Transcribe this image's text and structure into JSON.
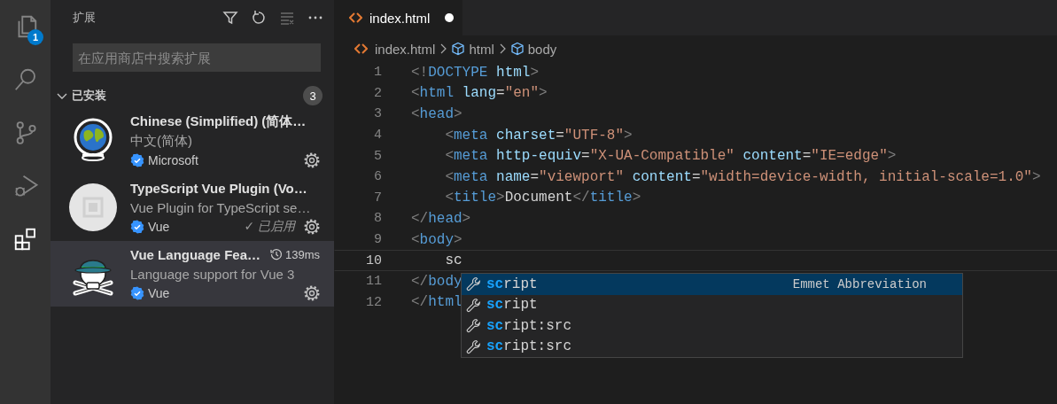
{
  "activity_bar": {
    "items": [
      {
        "kind": "files",
        "selected": false,
        "badge": "1"
      },
      {
        "kind": "search",
        "selected": false
      },
      {
        "kind": "source-control",
        "selected": false
      },
      {
        "kind": "run-debug",
        "selected": false
      },
      {
        "kind": "extensions",
        "selected": true
      }
    ]
  },
  "sidebar": {
    "title": "扩展",
    "actions": [
      {
        "kind": "filter"
      },
      {
        "kind": "refresh"
      },
      {
        "kind": "clear"
      },
      {
        "kind": "more"
      }
    ],
    "search": {
      "placeholder": "在应用商店中搜索扩展"
    },
    "section": {
      "title": "已安装",
      "expanded": true,
      "count": "3"
    },
    "extensions": [
      {
        "kind": "globe",
        "name": "Chinese (Simplified) (简体…",
        "description": "中文(简体)",
        "publisher": "Microsoft",
        "verified": true,
        "selected": false
      },
      {
        "kind": "plugin",
        "name": "TypeScript Vue Plugin (Vo…",
        "description": "Vue Plugin for TypeScript se…",
        "publisher": "Vue",
        "verified": true,
        "status": "✓ 已启用",
        "selected": false
      },
      {
        "kind": "skull",
        "name": "Vue Language Fea…",
        "activation_time": "139ms",
        "description": "Language support for Vue 3",
        "publisher": "Vue",
        "verified": true,
        "selected": true
      }
    ]
  },
  "editor": {
    "tabs": [
      {
        "label": "index.html",
        "selected": true,
        "dirty": true
      }
    ],
    "breadcrumbs": [
      {
        "kind": "file",
        "label": "index.html"
      },
      {
        "kind": "element",
        "label": "html"
      },
      {
        "kind": "element",
        "label": "body"
      }
    ],
    "lines": [
      {
        "number": "1",
        "current": false,
        "tokens": [
          {
            "kind": "punct",
            "text": "<!"
          },
          {
            "kind": "tag",
            "text": "DOCTYPE"
          },
          {
            "kind": "attr",
            "text": " html"
          },
          {
            "kind": "punct",
            "text": ">"
          }
        ]
      },
      {
        "number": "2",
        "current": false,
        "tokens": [
          {
            "kind": "punct",
            "text": "<"
          },
          {
            "kind": "tag",
            "text": "html"
          },
          {
            "kind": "attr",
            "text": " lang"
          },
          {
            "kind": "text",
            "text": "="
          },
          {
            "kind": "string",
            "text": "\"en\""
          },
          {
            "kind": "punct",
            "text": ">"
          }
        ]
      },
      {
        "number": "3",
        "current": false,
        "tokens": [
          {
            "kind": "punct",
            "text": "<"
          },
          {
            "kind": "tag",
            "text": "head"
          },
          {
            "kind": "punct",
            "text": ">"
          }
        ]
      },
      {
        "number": "4",
        "current": false,
        "tokens": [
          {
            "kind": "punct",
            "text": "    <"
          },
          {
            "kind": "tag",
            "text": "meta"
          },
          {
            "kind": "attr",
            "text": " charset"
          },
          {
            "kind": "text",
            "text": "="
          },
          {
            "kind": "string",
            "text": "\"UTF-8\""
          },
          {
            "kind": "punct",
            "text": ">"
          }
        ]
      },
      {
        "number": "5",
        "current": false,
        "tokens": [
          {
            "kind": "punct",
            "text": "    <"
          },
          {
            "kind": "tag",
            "text": "meta"
          },
          {
            "kind": "attr",
            "text": " http-equiv"
          },
          {
            "kind": "text",
            "text": "="
          },
          {
            "kind": "string",
            "text": "\"X-UA-Compatible\""
          },
          {
            "kind": "attr",
            "text": " content"
          },
          {
            "kind": "text",
            "text": "="
          },
          {
            "kind": "string",
            "text": "\"IE=edge\""
          },
          {
            "kind": "punct",
            "text": ">"
          }
        ]
      },
      {
        "number": "6",
        "current": false,
        "tokens": [
          {
            "kind": "punct",
            "text": "    <"
          },
          {
            "kind": "tag",
            "text": "meta"
          },
          {
            "kind": "attr",
            "text": " name"
          },
          {
            "kind": "text",
            "text": "="
          },
          {
            "kind": "string",
            "text": "\"viewport\""
          },
          {
            "kind": "attr",
            "text": " content"
          },
          {
            "kind": "text",
            "text": "="
          },
          {
            "kind": "string",
            "text": "\"width=device-width, initial-scale=1.0\""
          },
          {
            "kind": "punct",
            "text": ">"
          }
        ]
      },
      {
        "number": "7",
        "current": false,
        "tokens": [
          {
            "kind": "punct",
            "text": "    <"
          },
          {
            "kind": "tag",
            "text": "title"
          },
          {
            "kind": "punct",
            "text": ">"
          },
          {
            "kind": "text",
            "text": "Document"
          },
          {
            "kind": "punct",
            "text": "</"
          },
          {
            "kind": "tag",
            "text": "title"
          },
          {
            "kind": "punct",
            "text": ">"
          }
        ]
      },
      {
        "number": "8",
        "current": false,
        "tokens": [
          {
            "kind": "punct",
            "text": "</"
          },
          {
            "kind": "tag",
            "text": "head"
          },
          {
            "kind": "punct",
            "text": ">"
          }
        ]
      },
      {
        "number": "9",
        "current": false,
        "tokens": [
          {
            "kind": "punct",
            "text": "<"
          },
          {
            "kind": "tag",
            "text": "body"
          },
          {
            "kind": "punct",
            "text": ">"
          }
        ]
      },
      {
        "number": "10",
        "current": true,
        "tokens": [
          {
            "kind": "text",
            "text": "    sc"
          }
        ]
      },
      {
        "number": "11",
        "current": false,
        "tokens": [
          {
            "kind": "punct",
            "text": "</"
          },
          {
            "kind": "tag",
            "text": "body"
          }
        ]
      },
      {
        "number": "12",
        "current": false,
        "tokens": [
          {
            "kind": "punct",
            "text": "</"
          },
          {
            "kind": "tag",
            "text": "html"
          }
        ]
      }
    ],
    "suggestions": [
      {
        "match": "sc",
        "rest": "ript",
        "detail": "Emmet Abbreviation",
        "selected": true
      },
      {
        "match": "sc",
        "rest": "ript",
        "selected": false
      },
      {
        "match": "sc",
        "rest": "ript:src",
        "selected": false
      },
      {
        "match": "sc",
        "rest": "ript:src",
        "selected": false
      }
    ]
  }
}
